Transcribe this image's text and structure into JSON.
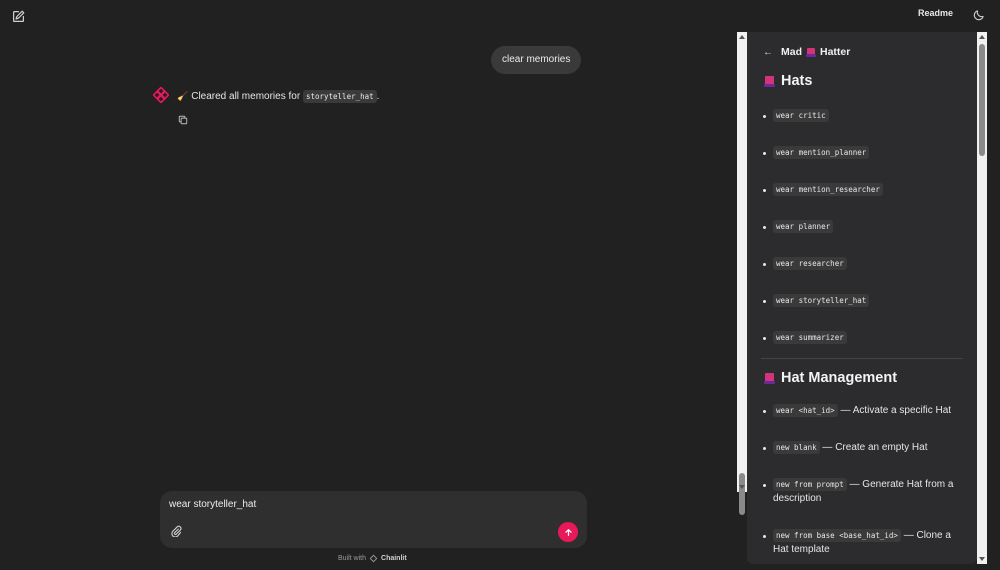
{
  "header": {
    "new_chat_icon": "edit-icon",
    "readme_label": "Readme",
    "theme_icon": "moon-icon"
  },
  "chat": {
    "user_message": "clear memories",
    "assistant": {
      "avatar_icon": "chainlit-logo-icon",
      "emoji_icon": "broom-icon",
      "text_before": "Cleared all memories for",
      "code": "storyteller_hat",
      "text_after": ".",
      "copy_icon": "copy-icon"
    }
  },
  "composer": {
    "value": "wear storyteller_hat",
    "attach_icon": "paperclip-icon",
    "send_icon": "arrow-up-icon"
  },
  "footer": {
    "prefix": "Built with",
    "brand": "Chainlit"
  },
  "panel": {
    "header": {
      "back_icon": "arrow-left-icon",
      "title_part1": "Mad",
      "title_part2": "Hatter"
    },
    "hats": {
      "title": "Hats",
      "items": [
        "wear critic",
        "wear mention_planner",
        "wear mention_researcher",
        "wear planner",
        "wear researcher",
        "wear storyteller_hat",
        "wear summarizer"
      ]
    },
    "management": {
      "title": "Hat Management",
      "items": [
        {
          "code": "wear <hat_id>",
          "text": "— Activate a specific Hat"
        },
        {
          "code": "new blank",
          "text": "— Create an empty Hat"
        },
        {
          "code": "new from prompt",
          "text": "— Generate Hat from a description"
        },
        {
          "code": "new from base <base_hat_id>",
          "text": "— Clone a Hat template"
        }
      ]
    }
  },
  "colors": {
    "background": "#212121",
    "panel": "#2c2b2d",
    "accent": "#e8195a",
    "bubble": "#3a3a3a"
  }
}
